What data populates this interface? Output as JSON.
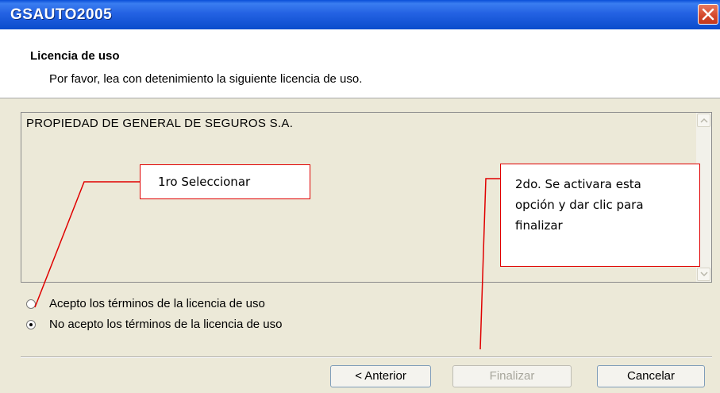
{
  "window": {
    "title": "GSAUTO2005",
    "close_icon": "close-icon"
  },
  "header": {
    "title": "Licencia de uso",
    "subtitle": "Por favor, lea con detenimiento la siguiente licencia de uso."
  },
  "license": {
    "text": "PROPIEDAD DE GENERAL DE SEGUROS S.A.",
    "scroll_up_icon": "scroll-up-icon",
    "scroll_down_icon": "scroll-down-icon"
  },
  "options": {
    "accept_label": "Acepto los términos de la licencia de uso",
    "reject_label": "No acepto los términos de la licencia de uso",
    "selected": "reject"
  },
  "buttons": {
    "back": "< Anterior",
    "finish": "Finalizar",
    "cancel": "Cancelar",
    "finish_enabled": false
  },
  "annotations": {
    "step1": "1ro Seleccionar",
    "step2": "2do. Se activara esta opción y dar clic para finalizar",
    "color": "#e00000"
  }
}
